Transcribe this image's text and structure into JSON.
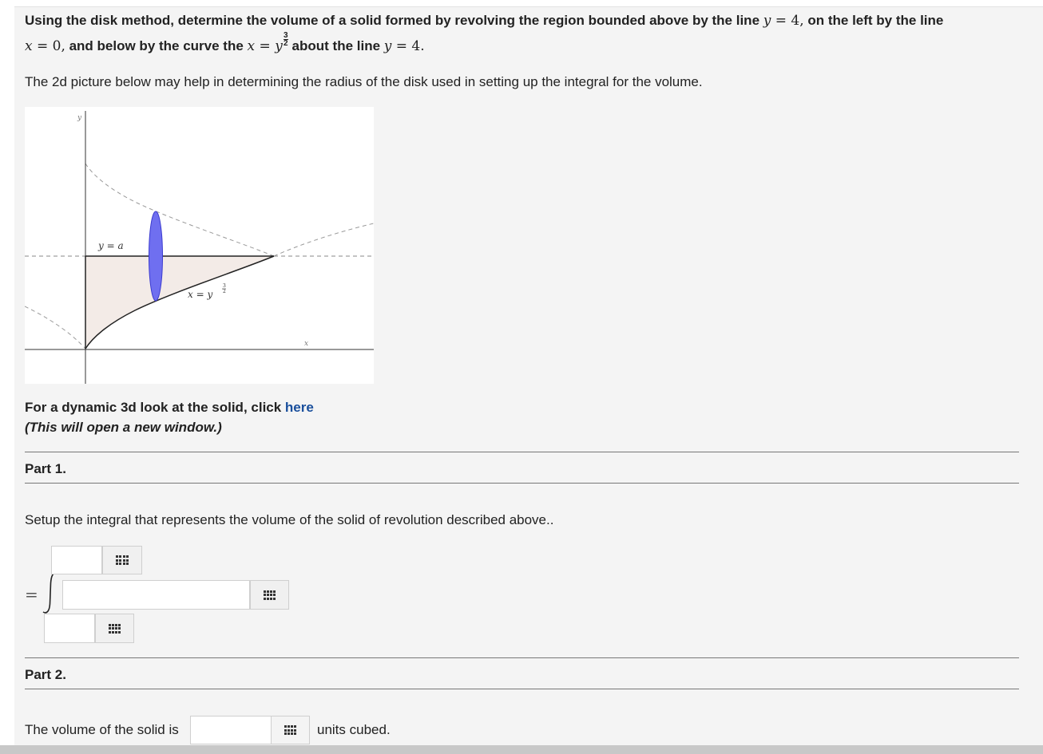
{
  "question": {
    "line1_text_a": "Using the disk method, determine the volume of a solid formed by revolving the region bounded above by the line ",
    "line1_math_var": "y",
    "line1_math_eq": " = 4,",
    "line1_text_b": " on the left by the line",
    "line2_math_a": "x",
    "line2_math_a_eq": " = 0,",
    "line2_text_a": " and below by the curve the ",
    "line2_math_b": "x",
    "line2_math_b_eq": " = ",
    "line2_math_b_y": "y",
    "exp_num": "3",
    "exp_den": "2",
    "line2_text_b": " about the line ",
    "line2_math_c": "y",
    "line2_math_c_eq": " = 4."
  },
  "hint": "The 2d picture below may help in determining the radius of the disk used in setting up the integral for the volume.",
  "figure": {
    "y_axis_label": "y",
    "x_axis_label": "x",
    "line_label": "y = a",
    "curve_label_base": "x = y",
    "curve_label_num": "3",
    "curve_label_den": "2",
    "disk_color": "#6f6ff0",
    "region_color": "#f3ebe7"
  },
  "dynamic": {
    "text": "For a dynamic 3d look at the solid, click ",
    "link": "here",
    "note": "(This will open a new window.)"
  },
  "part1": {
    "title": "Part 1.",
    "prompt": "Setup the integral that represents the volume of the solid of revolution described above..",
    "equals": "=",
    "integral": "∫"
  },
  "part2": {
    "title": "Part 2.",
    "prefix": "The volume of the solid is",
    "suffix": "units cubed."
  }
}
